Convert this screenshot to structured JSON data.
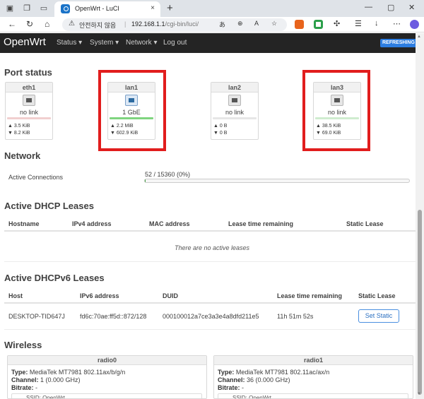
{
  "browser": {
    "tab_title": "OpenWrt - LuCI",
    "tab_close": "×",
    "new_tab": "+",
    "omnibox": {
      "warning": "⚠",
      "security_text": "안전하지 않음",
      "separator": "|",
      "url_host": "192.168.1.1",
      "url_path": "/cgi-bin/luci/"
    }
  },
  "header": {
    "brand": "OpenWrt",
    "menu": [
      "Status",
      "System",
      "Network",
      "Log out"
    ],
    "badge": "REFRESHING"
  },
  "port_status": {
    "title": "Port status",
    "ports": [
      {
        "name": "eth1",
        "speed": "no link",
        "tx": "▲ 3.5 KiB",
        "rx": "▼ 8.2 KiB",
        "bar_color": "#f1cfcf",
        "up": false
      },
      {
        "name": "lan1",
        "speed": "1 GbE",
        "tx": "▲ 2.2 MiB",
        "rx": "▼ 602.9 KiB",
        "bar_color": "#7fd47f",
        "up": true
      },
      {
        "name": "lan2",
        "speed": "no link",
        "tx": "▲ 0 B",
        "rx": "▼ 0 B",
        "bar_color": "#e6e6e6",
        "up": false
      },
      {
        "name": "lan3",
        "speed": "no link",
        "tx": "▲ 38.5 KiB",
        "rx": "▼ 69.0 KiB",
        "bar_color": "#cfeccf",
        "up": false
      }
    ]
  },
  "network": {
    "title": "Network",
    "label": "Active Connections",
    "value": "52 / 15360 (0%)",
    "progress": 0.0034
  },
  "dhcp": {
    "title": "Active DHCP Leases",
    "columns": [
      "Hostname",
      "IPv4 address",
      "MAC address",
      "Lease time remaining",
      "Static Lease"
    ],
    "empty": "There are no active leases"
  },
  "dhcp6": {
    "title": "Active DHCPv6 Leases",
    "columns": [
      "Host",
      "IPv6 address",
      "DUID",
      "Lease time remaining",
      "Static Lease"
    ],
    "row": {
      "host": "DESKTOP-TID647J",
      "ipv6": "fd6c:70ae:ff5d::872/128",
      "duid": "000100012a7ce3a3e4a8dfd211e5",
      "lease": "11h 51m 52s",
      "button": "Set Static"
    }
  },
  "wireless": {
    "title": "Wireless",
    "radios": [
      {
        "name": "radio0",
        "type_label": "Type:",
        "type": "MediaTek MT7981 802.11ax/b/g/n",
        "channel_label": "Channel:",
        "channel": "1 (0.000 GHz)",
        "bitrate_label": "Bitrate:",
        "bitrate": "-",
        "ssid": "SSID: OpenWrt"
      },
      {
        "name": "radio1",
        "type_label": "Type:",
        "type": "MediaTek MT7981 802.11ac/ax/n",
        "channel_label": "Channel:",
        "channel": "36 (0.000 GHz)",
        "bitrate_label": "Bitrate:",
        "bitrate": "-",
        "ssid": "SSID: OpenWrt"
      }
    ]
  },
  "colors": {
    "header_bg": "#242424",
    "accent": "#2d7de0",
    "highlight_box": "#e11d1d"
  }
}
